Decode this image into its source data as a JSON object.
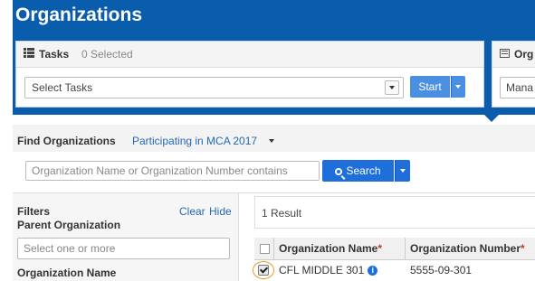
{
  "page": {
    "title": "Organizations"
  },
  "tasks": {
    "title": "Tasks",
    "selected_count": "0 Selected",
    "select_placeholder": "Select Tasks",
    "start_label": "Start"
  },
  "org_panel": {
    "title_partial": "Org",
    "manage_partial": "Mana"
  },
  "find": {
    "label": "Find Organizations",
    "filter_value": "Participating in MCA 2017",
    "search_placeholder": "Organization Name or Organization Number contains",
    "search_label": "Search"
  },
  "filters": {
    "title": "Filters",
    "clear_label": "Clear",
    "hide_label": "Hide",
    "parent_org_label": "Parent Organization",
    "parent_org_placeholder": "Select one or more",
    "org_name_label": "Organization Name"
  },
  "results": {
    "count_text": "1 Result",
    "columns": [
      "Organization Name",
      "Organization Number"
    ],
    "required_marker": "*",
    "rows": [
      {
        "name": "CFL MIDDLE 301",
        "number": "5555-09-301",
        "checked": true
      }
    ]
  },
  "icons": {
    "info": "i"
  },
  "colors": {
    "header_blue": "#0a5cad",
    "button_blue": "#1e6fd9",
    "link_blue": "#2369b7",
    "highlight_orange": "#f0961e"
  }
}
